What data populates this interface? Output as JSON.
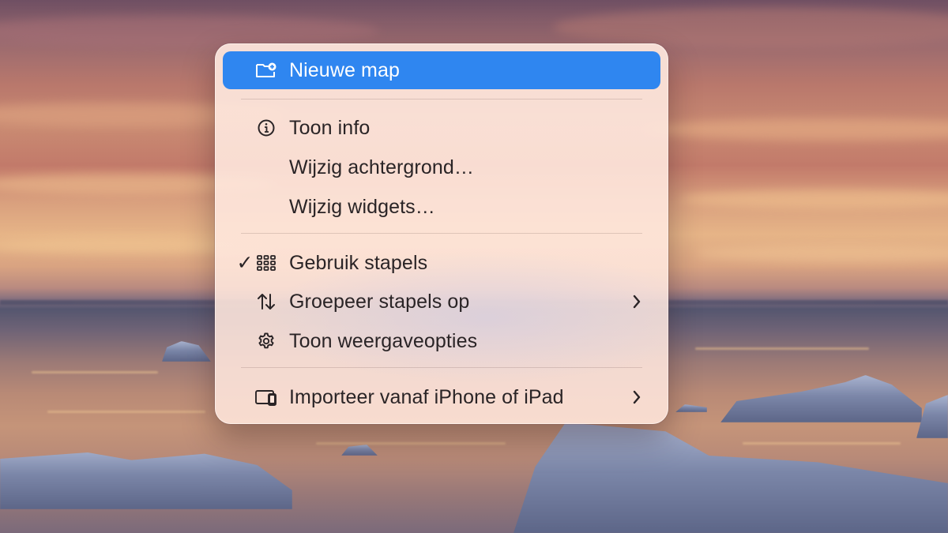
{
  "desktop": {
    "wallpaper": "sunset-over-sea-with-icebergs"
  },
  "menu": {
    "highlight_color": "#2f86f0",
    "items": [
      {
        "label": "Nieuwe map",
        "icon": "new-folder-icon",
        "checked": false,
        "submenu": false,
        "highlighted": true
      },
      {
        "label": "Toon info",
        "icon": "info-icon",
        "checked": false,
        "submenu": false,
        "highlighted": false
      },
      {
        "label": "Wijzig achtergrond…",
        "icon": "",
        "checked": false,
        "submenu": false,
        "highlighted": false
      },
      {
        "label": "Wijzig widgets…",
        "icon": "",
        "checked": false,
        "submenu": false,
        "highlighted": false
      },
      {
        "label": "Gebruik stapels",
        "icon": "stacks-grid-icon",
        "checked": true,
        "check_mark": "✓",
        "submenu": false,
        "highlighted": false
      },
      {
        "label": "Groepeer stapels op",
        "icon": "sort-arrows-icon",
        "checked": false,
        "submenu": true,
        "highlighted": false
      },
      {
        "label": "Toon weergaveopties",
        "icon": "gear-icon",
        "checked": false,
        "submenu": false,
        "highlighted": false
      },
      {
        "label": "Importeer vanaf iPhone of iPad",
        "icon": "iphone-ipad-icon",
        "checked": false,
        "submenu": true,
        "highlighted": false
      }
    ]
  }
}
